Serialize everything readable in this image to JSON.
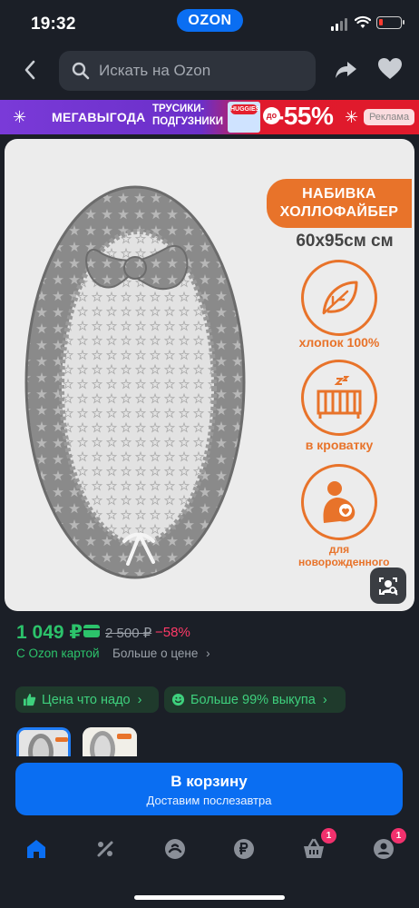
{
  "status_bar": {
    "time": "19:32",
    "brand": "OZON"
  },
  "header": {
    "search_placeholder": "Искать на Ozon"
  },
  "ad_banner": {
    "headline": "МЕГАВЫГОДА",
    "product_line1": "ТРУСИКИ-",
    "product_line2": "ПОДГУЗНИКИ",
    "pack_brand": "HUGGIES",
    "prefix": "до",
    "discount": "-55%",
    "ad_label": "Реклама"
  },
  "product_image": {
    "fill_line1": "НАБИВКА",
    "fill_line2": "ХОЛЛОФАЙБЕР",
    "size": "60x95см см",
    "features": [
      "хлопок 100%",
      "в кроватку",
      "для новорожденного"
    ]
  },
  "price": {
    "current": "1 049 ₽",
    "old": "2 500 ₽",
    "discount": "−58%",
    "card_label": "С Ozon картой",
    "more_label": "Больше о цене"
  },
  "chips": [
    {
      "label": "Цена что надо"
    },
    {
      "label": "Больше 99% выкупа"
    }
  ],
  "cart": {
    "title": "В корзину",
    "subtitle": "Доставим послезавтра"
  },
  "tab_bar": {
    "items": [
      {
        "icon": "home-icon"
      },
      {
        "icon": "percent-icon"
      },
      {
        "icon": "fresh-icon"
      },
      {
        "icon": "ruble-icon"
      },
      {
        "icon": "cart-icon",
        "badge": "1"
      },
      {
        "icon": "profile-icon",
        "badge": "1"
      }
    ]
  },
  "colors": {
    "background": "#1b1f27",
    "accent_blue": "#0a6ef2",
    "price_green": "#2cc36b",
    "discount_pink": "#ff3a68",
    "badge_pink": "#f2316d",
    "image_orange": "#e8732a"
  }
}
